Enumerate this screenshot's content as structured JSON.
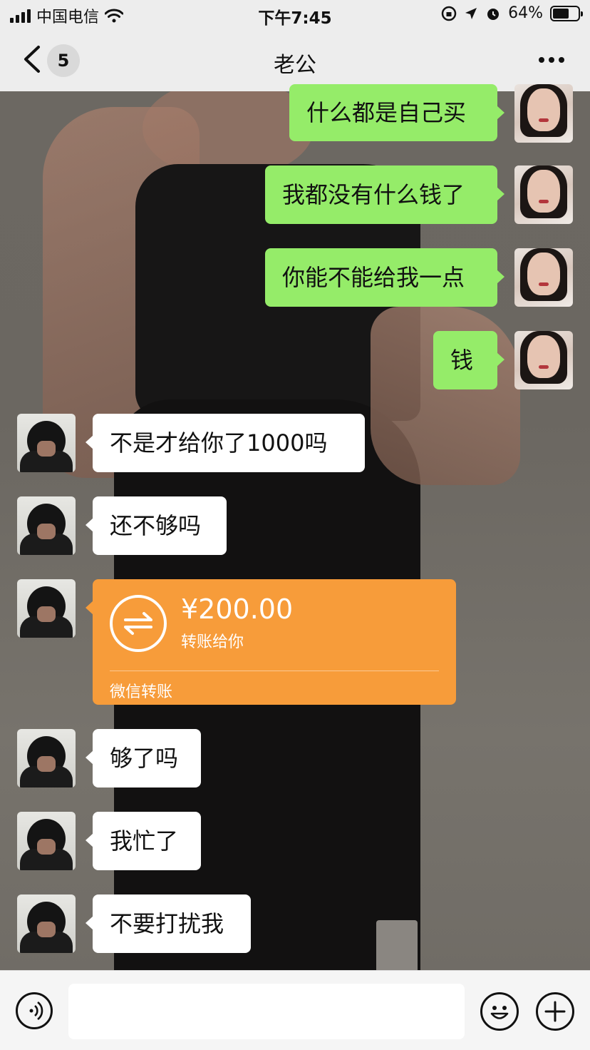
{
  "status_bar": {
    "carrier": "中国电信",
    "time": "下午7:45",
    "battery": "64%",
    "battery_level": 0.64
  },
  "nav": {
    "unread_count": "5",
    "title": "老公"
  },
  "messages": [
    {
      "side": "me",
      "text": "什么都是自己买"
    },
    {
      "side": "me",
      "text": "我都没有什么钱了"
    },
    {
      "side": "me",
      "text": "你能不能给我一点"
    },
    {
      "side": "me",
      "text": "钱"
    },
    {
      "side": "other",
      "text": "不是才给你了1000吗"
    },
    {
      "side": "other",
      "text": "还不够吗"
    },
    {
      "side": "other",
      "type": "transfer"
    },
    {
      "side": "other",
      "text": "够了吗"
    },
    {
      "side": "other",
      "text": "我忙了"
    },
    {
      "side": "other",
      "text": "不要打扰我"
    }
  ],
  "transfer": {
    "amount": "¥200.00",
    "description": "转账给你",
    "footer": "微信转账",
    "color": "#f79c3a"
  },
  "colors": {
    "my_bubble": "#95ec69",
    "other_bubble": "#ffffff",
    "bar_bg": "#ededed"
  },
  "icons": {
    "back": "chevron-left-icon",
    "more": "more-dots-icon",
    "voice": "voice-icon",
    "emoji": "emoji-icon",
    "plus": "plus-icon",
    "transfer": "transfer-arrows-icon"
  }
}
